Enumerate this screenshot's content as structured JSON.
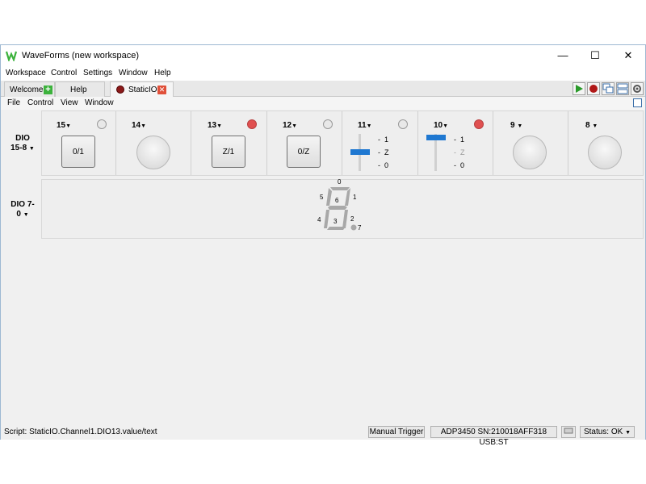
{
  "window": {
    "title": "WaveForms (new workspace)",
    "min": "—",
    "max": "☐",
    "close": "✕"
  },
  "menu": [
    "Workspace",
    "Control",
    "Settings",
    "Window",
    "Help"
  ],
  "tabs": [
    {
      "label": "Welcome"
    },
    {
      "label": "Help"
    },
    {
      "label": "StaticIO"
    }
  ],
  "submenu": [
    "File",
    "Control",
    "View",
    "Window"
  ],
  "groups": {
    "a": "DIO 15-8",
    "b": "DIO 7-0"
  },
  "channels": [
    {
      "num": "15",
      "type": "button",
      "label": "0/1",
      "led": "off"
    },
    {
      "num": "14",
      "type": "led"
    },
    {
      "num": "13",
      "type": "button",
      "label": "Z/1",
      "led": "on"
    },
    {
      "num": "12",
      "type": "button",
      "label": "0/Z",
      "led": "off"
    },
    {
      "num": "11",
      "type": "slider",
      "levels": [
        "1",
        "Z",
        "0"
      ],
      "selected": "Z",
      "led": "off"
    },
    {
      "num": "10",
      "type": "slider",
      "levels": [
        "1",
        "Z",
        "0"
      ],
      "selected": "1",
      "led": "on"
    },
    {
      "num": "9",
      "type": "led"
    },
    {
      "num": "8",
      "type": "led"
    }
  ],
  "seven_segment": {
    "segments": [
      "0",
      "1",
      "2",
      "3",
      "4",
      "5",
      "6",
      "7"
    ]
  },
  "status": {
    "script": "Script: StaticIO.Channel1.DIO13.value/text",
    "trigger": "Manual Trigger",
    "device": "ADP3450 SN:210018AFF318 USB:ST",
    "state": "Status: OK"
  },
  "colors": {
    "accent": "#1f78d1",
    "led_on": "#e05050",
    "logo": "#3cb23c"
  }
}
